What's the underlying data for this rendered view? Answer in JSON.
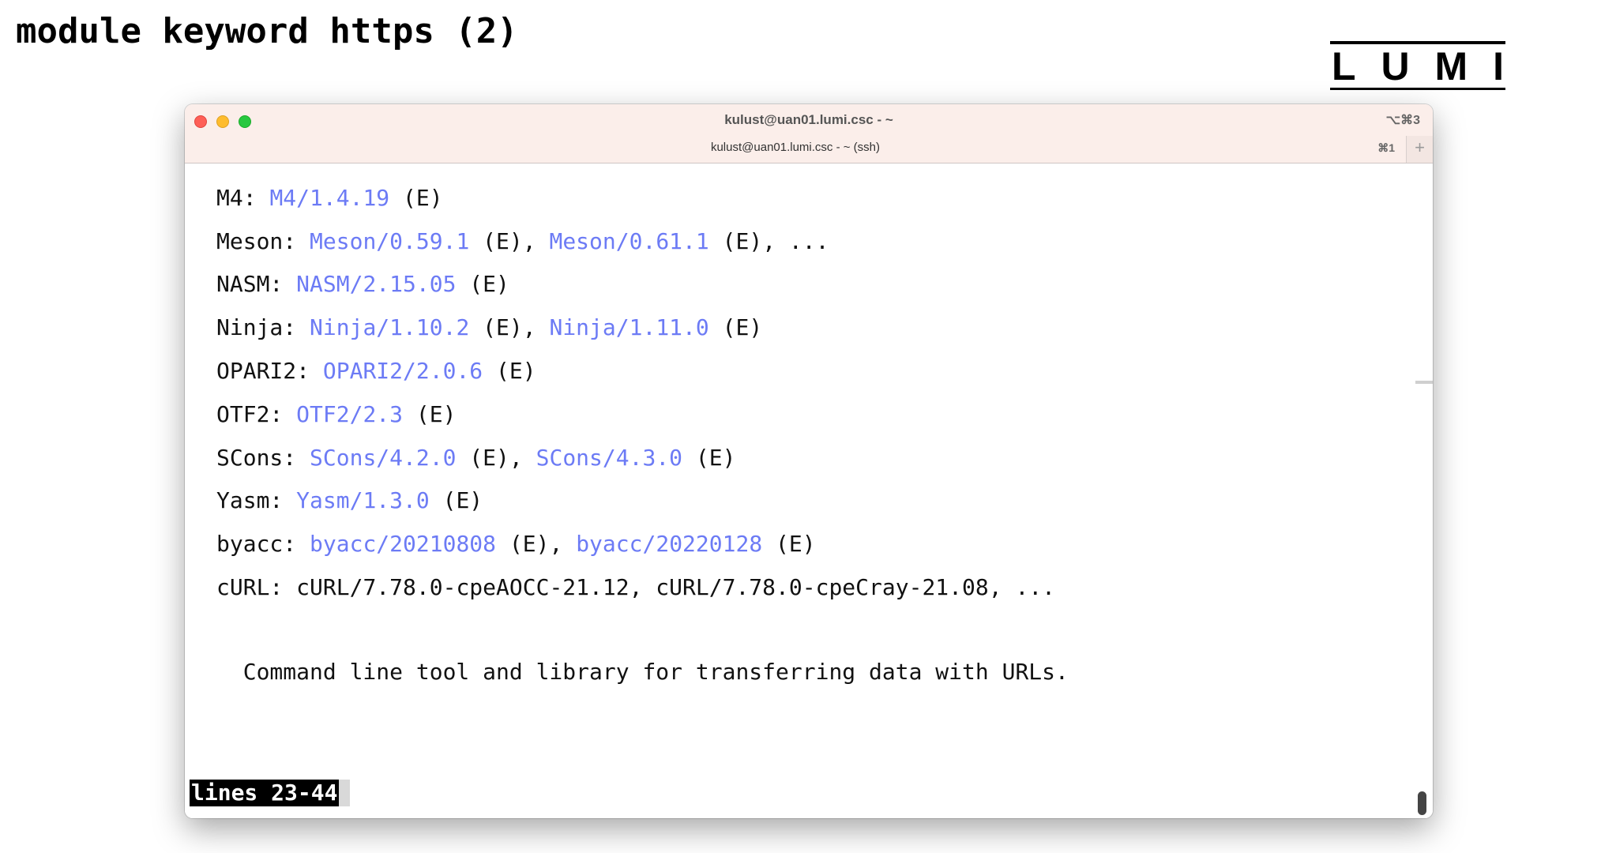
{
  "slide": {
    "title": "module keyword https (2)",
    "logo_letters": [
      "L",
      "U",
      "M",
      "I"
    ]
  },
  "window": {
    "title": "kulust@uan01.lumi.csc - ~",
    "shortcut": "⌥⌘3",
    "tab_label": "kulust@uan01.lumi.csc - ~ (ssh)",
    "tab_shortcut": "⌘1",
    "tab_add": "+"
  },
  "terminal": {
    "lines": [
      {
        "name": "M4:",
        "parts": [
          {
            "t": " "
          },
          {
            "l": "M4/1.4.19"
          },
          {
            "t": " (E)"
          }
        ]
      },
      {
        "name": "Meson:",
        "parts": [
          {
            "t": " "
          },
          {
            "l": "Meson/0.59.1"
          },
          {
            "t": " (E), "
          },
          {
            "l": "Meson/0.61.1"
          },
          {
            "t": " (E), ..."
          }
        ]
      },
      {
        "name": "NASM:",
        "parts": [
          {
            "t": " "
          },
          {
            "l": "NASM/2.15.05"
          },
          {
            "t": " (E)"
          }
        ]
      },
      {
        "name": "Ninja:",
        "parts": [
          {
            "t": " "
          },
          {
            "l": "Ninja/1.10.2"
          },
          {
            "t": " (E), "
          },
          {
            "l": "Ninja/1.11.0"
          },
          {
            "t": " (E)"
          }
        ]
      },
      {
        "name": "OPARI2:",
        "parts": [
          {
            "t": " "
          },
          {
            "l": "OPARI2/2.0.6"
          },
          {
            "t": " (E)"
          }
        ]
      },
      {
        "name": "OTF2:",
        "parts": [
          {
            "t": " "
          },
          {
            "l": "OTF2/2.3"
          },
          {
            "t": " (E)"
          }
        ]
      },
      {
        "name": "SCons:",
        "parts": [
          {
            "t": " "
          },
          {
            "l": "SCons/4.2.0"
          },
          {
            "t": " (E), "
          },
          {
            "l": "SCons/4.3.0"
          },
          {
            "t": " (E)"
          }
        ]
      },
      {
        "name": "Yasm:",
        "parts": [
          {
            "t": " "
          },
          {
            "l": "Yasm/1.3.0"
          },
          {
            "t": " (E)"
          }
        ]
      },
      {
        "name": "byacc:",
        "parts": [
          {
            "t": " "
          },
          {
            "l": "byacc/20210808"
          },
          {
            "t": " (E), "
          },
          {
            "l": "byacc/20220128"
          },
          {
            "t": " (E)"
          }
        ]
      },
      {
        "name": "cURL:",
        "parts": [
          {
            "t": " cURL/7.78.0-cpeAOCC-21.12, cURL/7.78.0-cpeCray-21.08, ..."
          }
        ]
      }
    ],
    "description": "  Command line tool and library for transferring data with URLs.",
    "status": "lines 23-44",
    "link_color": "#6c7bf5"
  }
}
